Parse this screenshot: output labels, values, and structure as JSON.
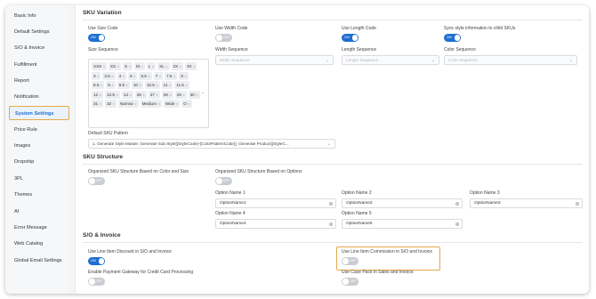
{
  "sidebar": {
    "items": [
      {
        "label": "Basic Info",
        "active": false
      },
      {
        "label": "Default Settings",
        "active": false
      },
      {
        "label": "S/O & Invoice",
        "active": false
      },
      {
        "label": "Fulfillment",
        "active": false
      },
      {
        "label": "Report",
        "active": false
      },
      {
        "label": "Notification",
        "active": false
      },
      {
        "label": "System Settings",
        "active": true
      },
      {
        "label": "Price Rule",
        "active": false
      },
      {
        "label": "Images",
        "active": false
      },
      {
        "label": "Dropship",
        "active": false
      },
      {
        "label": "3PL",
        "active": false
      },
      {
        "label": "Themes",
        "active": false
      },
      {
        "label": "AI",
        "active": false
      },
      {
        "label": "Error Message",
        "active": false
      },
      {
        "label": "Web Catalog",
        "active": false
      },
      {
        "label": "Global Email Settings",
        "active": false
      }
    ]
  },
  "sku_variation": {
    "title": "SKU Variation",
    "use_size_code": {
      "label": "Use Size Code",
      "state": "on",
      "state_text": "ON"
    },
    "size_sequence": {
      "label": "Size Sequence",
      "tags": [
        "XXS",
        "XS",
        "S",
        "M",
        "L",
        "XL",
        "2X",
        "3X",
        "3",
        "3.5",
        "4",
        "6",
        "6.5",
        "7",
        "7.5",
        "8",
        "8.5",
        "9",
        "9.5",
        "10",
        "10.5",
        "11",
        "11.5",
        "12",
        "12.5",
        "13",
        "26",
        "27",
        "28",
        "29",
        "30",
        "31",
        "32",
        "Narrow",
        "Medium",
        "Wide",
        "O"
      ]
    },
    "use_width_code": {
      "label": "Use Width Code",
      "state": "off",
      "state_text": "OFF"
    },
    "width_sequence": {
      "label": "Width Sequence",
      "placeholder": "Width Sequence"
    },
    "use_length_code": {
      "label": "Use Length Code",
      "state": "on",
      "state_text": "ON"
    },
    "length_sequence": {
      "label": "Length Sequence",
      "placeholder": "Length Sequence"
    },
    "sync_style": {
      "label": "Sync style information to child SKUs",
      "state": "on",
      "state_text": "ON"
    },
    "color_sequence": {
      "label": "Color Sequence",
      "placeholder": "Color Sequence"
    },
    "default_sku_pattern": {
      "label": "Default SKU Pattern",
      "value": "1. Generate Style Master. Generate Sub Style[{StyleCode}-{ColorPatternCode}]. Generate Product[{StyleC..."
    }
  },
  "sku_structure": {
    "title": "SKU Structure",
    "organized_color_size": {
      "label": "Organized SKU Structure Based on Color and Size",
      "state": "off",
      "state_text": "OFF"
    },
    "organized_options": {
      "label": "Organized SKU Structure Based on Options",
      "state": "off",
      "state_text": "OFF"
    },
    "options": [
      {
        "label": "Option Name 1",
        "value": "OptionName1"
      },
      {
        "label": "Option Name 2",
        "value": "OptionName2"
      },
      {
        "label": "Option Name 3",
        "value": "OptionName3"
      },
      {
        "label": "Option Name 4",
        "value": "OptionName4"
      },
      {
        "label": "Option Name 5",
        "value": "OptionName5"
      }
    ]
  },
  "so_invoice": {
    "title": "S/O & Invoice",
    "line_item_discount": {
      "label": "Use Line Item Discount in S/O and Invoice",
      "state": "on",
      "state_text": "ON"
    },
    "line_item_commission": {
      "label": "Use Line Item Commission in S/O and Invoice",
      "state": "off",
      "state_text": "OFF"
    },
    "payment_gateway": {
      "label": "Enable Payment Gateway for Credit Card Processing",
      "state": "off",
      "state_text": "OFF"
    },
    "case_pack": {
      "label": "Use Case Pack in Sales and Invoice",
      "state": "off",
      "state_text": "OFF"
    }
  },
  "colors": {
    "accent": "#1f6fd0",
    "highlight": "#e7a94b",
    "toggle_off": "#c9cdd2"
  },
  "icons": {
    "remove_tag": "×",
    "clear_input": "×",
    "dropdown": "chevron-down"
  }
}
